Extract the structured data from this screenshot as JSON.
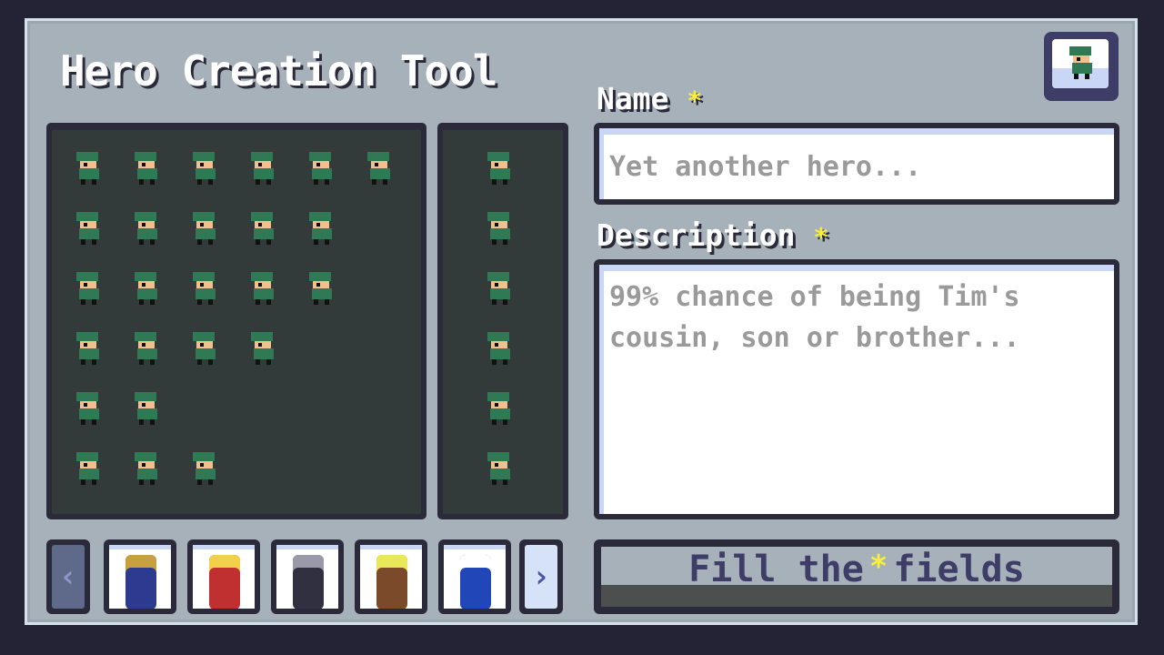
{
  "app": {
    "title": "Hero Creation Tool"
  },
  "form": {
    "name_label": "Name",
    "required_mark": "*",
    "name_placeholder": "Yet another hero...",
    "description_label": "Description",
    "description_placeholder": "99% chance of being Tim's cousin, son or brother..."
  },
  "carousel": {
    "prev_icon": "‹",
    "next_icon": "›",
    "thumbs": [
      {
        "name": "black-mage",
        "color": "#2c3b8f",
        "accent": "#c8a040"
      },
      {
        "name": "red-armored-hero",
        "color": "#c03030",
        "accent": "#f3d04a"
      },
      {
        "name": "dark-haired-swordswoman",
        "color": "#303040",
        "accent": "#9999aa"
      },
      {
        "name": "striped-shirt-kid",
        "color": "#7a4a2a",
        "accent": "#e8e85a"
      },
      {
        "name": "blue-hedgehog",
        "color": "#2046b8",
        "accent": "#ffffff"
      }
    ]
  },
  "submit": {
    "prefix": "Fill the",
    "star": "*",
    "suffix": "fields"
  },
  "colors": {
    "background": "#242336",
    "panel": "#a7b1ba",
    "hat_green": "#2f7a55",
    "required_yellow": "#f8ef3a"
  }
}
